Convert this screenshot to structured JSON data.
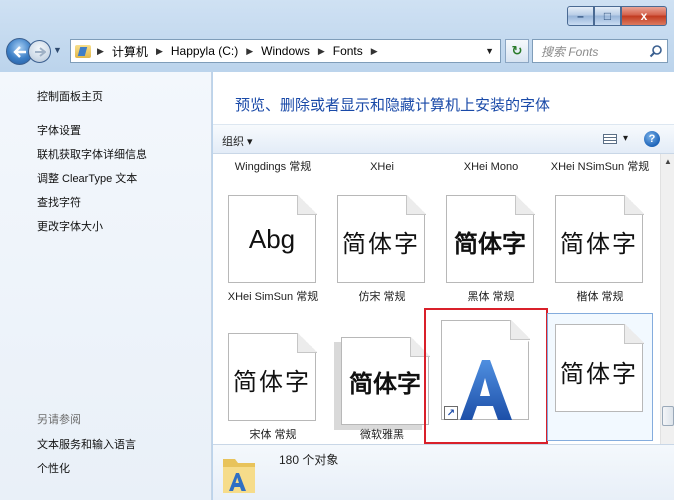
{
  "window": {
    "caption": {
      "minimize": "–",
      "maximize": "□",
      "close": "x"
    }
  },
  "navbar": {
    "breadcrumbs": [
      "计算机",
      "Happyla (C:)",
      "Windows",
      "Fonts"
    ],
    "search_placeholder": "搜索 Fonts"
  },
  "sidebar": {
    "items": [
      "控制面板主页",
      "字体设置",
      "联机获取字体详细信息",
      "调整 ClearType 文本",
      "查找字符",
      "更改字体大小"
    ],
    "see_also_title": "另请参阅",
    "see_also": [
      "文本服务和输入语言",
      "个性化"
    ]
  },
  "main": {
    "title": "预览、删除或者显示和隐藏计算机上安装的字体",
    "organize_label": "组织 ▾",
    "views_label": "▾",
    "help_label": "?"
  },
  "fonts": {
    "top_labels": [
      "Wingdings 常规",
      "XHei",
      "XHei Mono",
      "XHei NSimSun 常规"
    ],
    "row1": [
      {
        "sample": "Abg",
        "label": "XHei SimSun 常规"
      },
      {
        "sample": "简体字",
        "label": "仿宋 常规"
      },
      {
        "sample": "简体字",
        "label": "黑体 常规"
      },
      {
        "sample": "简体字",
        "label": "楷体 常规"
      }
    ],
    "row2": [
      {
        "sample": "简体字",
        "label": "宋体 常规"
      },
      {
        "sample": "简体字",
        "label": "微软雅黑"
      },
      {
        "sample": "A",
        "label": ""
      },
      {
        "sample": "简体字",
        "label": ""
      }
    ]
  },
  "details": {
    "count_text": "180 个对象"
  },
  "colors": {
    "selection": "#d9202a",
    "title_blue": "#1a4aa8",
    "hover": "#84acdd"
  }
}
